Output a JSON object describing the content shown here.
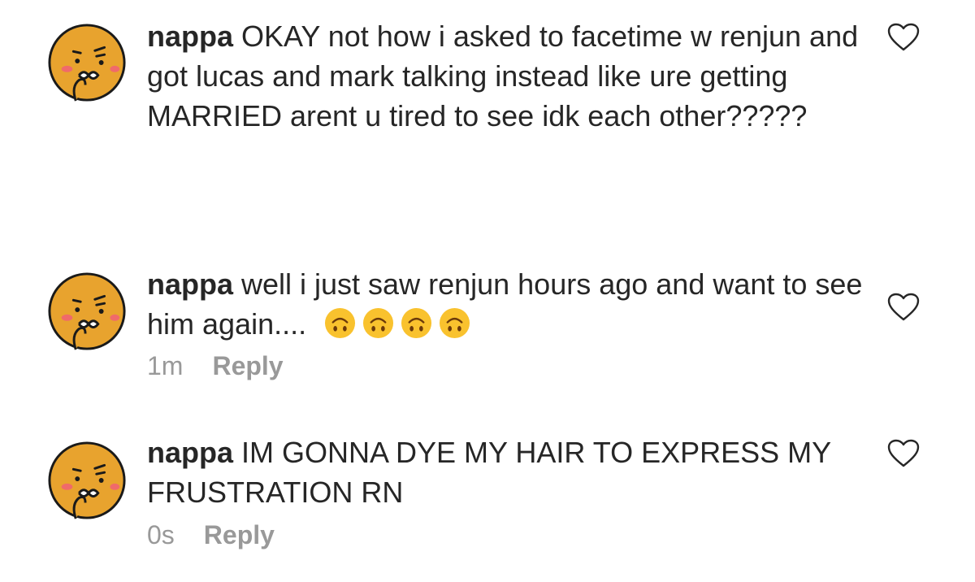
{
  "comments": [
    {
      "username": "nappa",
      "text": "OKAY not how i asked to facetime w renjun and got lucas and mark talking instead like ure getting MARRIED arent u tired to see idk each other?????",
      "time": "",
      "reply_label": "",
      "emojis": []
    },
    {
      "username": "nappa",
      "text": "well i just saw renjun hours ago and want to see him again....",
      "time": "1m",
      "reply_label": "Reply",
      "emojis": [
        "upside-down-face",
        "upside-down-face",
        "upside-down-face",
        "upside-down-face"
      ]
    },
    {
      "username": "nappa",
      "text": "IM GONNA DYE MY HAIR TO EXPRESS MY FRUSTRATION RN",
      "time": "0s",
      "reply_label": "Reply",
      "emojis": []
    }
  ],
  "colors": {
    "text": "#262626",
    "meta": "#999999",
    "avatar_face": "#E8A32E",
    "avatar_outline": "#1a1a1a",
    "avatar_blush": "#F06A6A",
    "emoji_face": "#F9C22E"
  },
  "icons": {
    "avatar": "ryan-kakao-avatar",
    "like": "heart-outline-icon",
    "emoji": "upside-down-face-emoji"
  }
}
